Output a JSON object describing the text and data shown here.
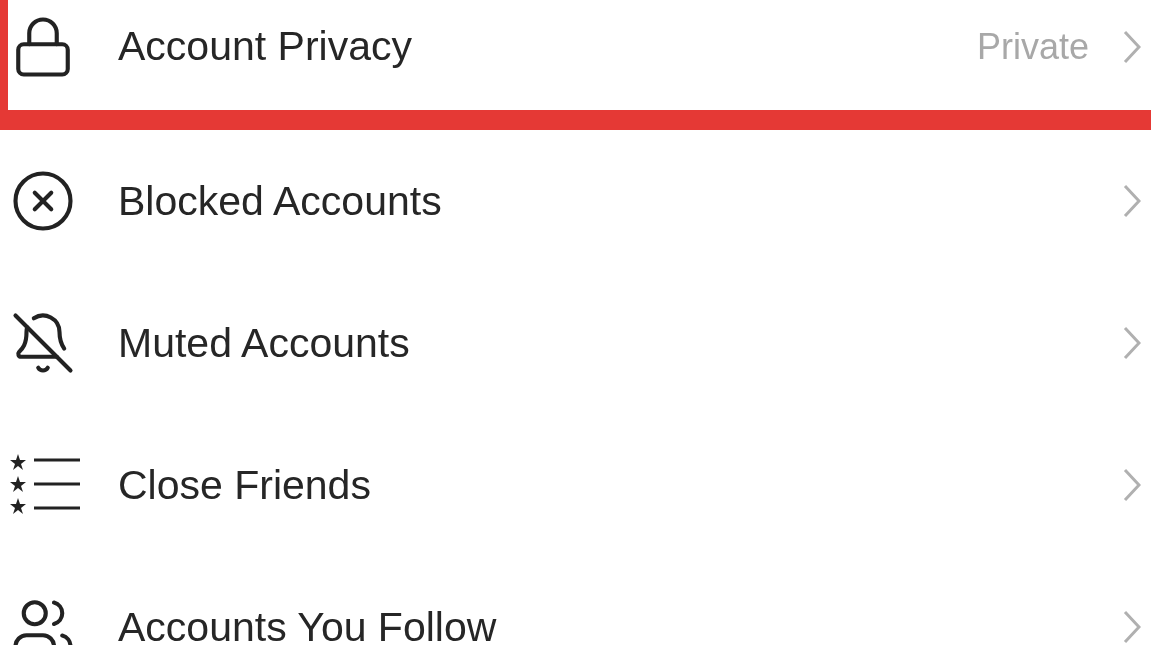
{
  "settings_rows": [
    {
      "kind": "lock",
      "label": "Account Privacy",
      "value": "Private",
      "highlighted": true
    },
    {
      "kind": "blocked",
      "label": "Blocked Accounts",
      "highlighted": false
    },
    {
      "kind": "muted",
      "label": "Muted Accounts",
      "highlighted": false
    },
    {
      "kind": "friends",
      "label": "Close Friends",
      "highlighted": false
    },
    {
      "kind": "people",
      "label": "Accounts You Follow",
      "highlighted": false
    }
  ]
}
